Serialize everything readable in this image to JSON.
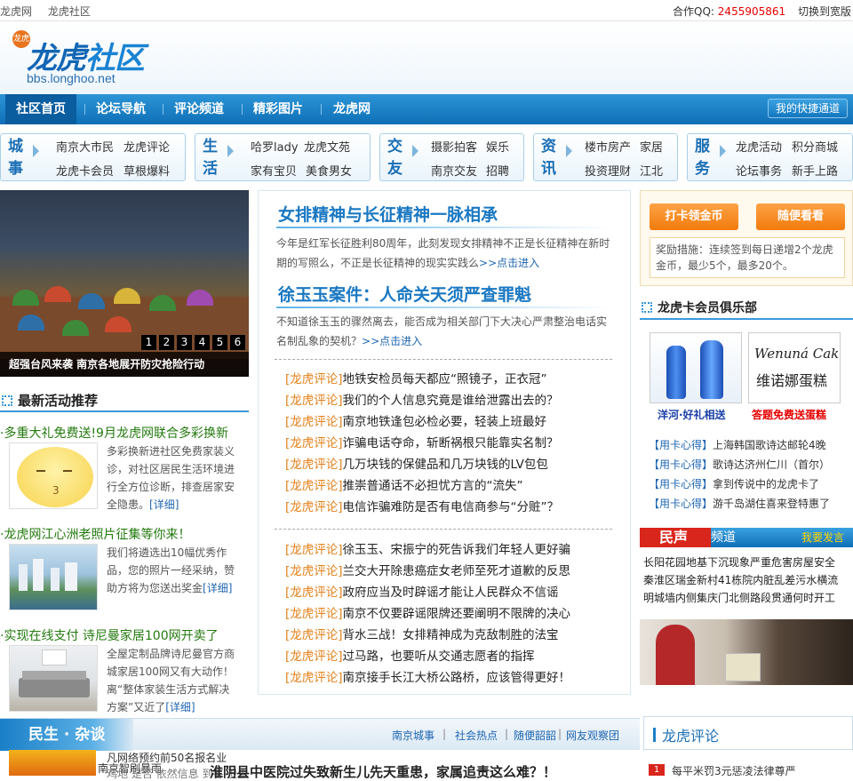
{
  "topbar": {
    "site": "龙虎网",
    "community": "龙虎社区",
    "qq_label": "合作QQ:",
    "qq_number": "2455905861",
    "switch_label": "切换到宽版"
  },
  "logo": {
    "seal": "龙虎",
    "name_a": "龙虎",
    "name_b": "社区",
    "url": "bbs.longhoo.net"
  },
  "nav": {
    "items": [
      "社区首页",
      "论坛导航",
      "评论频道",
      "精彩图片",
      "龙虎网"
    ],
    "quick": "我的快捷通道"
  },
  "categories": [
    {
      "t1": "城",
      "t2": "事",
      "links": [
        "南京大市民",
        "龙虎评论",
        "龙虎卡会员",
        "草根爆料"
      ]
    },
    {
      "t1": "生",
      "t2": "活",
      "links": [
        "哈罗lady",
        "龙虎文苑",
        "家有宝贝",
        "美食男女"
      ]
    },
    {
      "t1": "交",
      "t2": "友",
      "links": [
        "摄影拍客",
        "娱乐",
        "南京交友",
        "招聘"
      ]
    },
    {
      "t1": "资",
      "t2": "讯",
      "links": [
        "楼市房产",
        "家居",
        "投资理财",
        "江北"
      ]
    },
    {
      "t1": "服",
      "t2": "务",
      "links": [
        "龙虎活动",
        "积分商城",
        "论坛事务",
        "新手上路"
      ]
    }
  ],
  "slide": {
    "nums": [
      "1",
      "2",
      "3",
      "4",
      "5",
      "6"
    ],
    "caption": "超强台风来袭 南京各地展开防灾抢险行动"
  },
  "activities": {
    "title": "最新活动推荐",
    "items": [
      {
        "title": "·多重大礼免费送!9月龙虎网联合多彩换新",
        "desc": "多彩换新进社区免费家装义诊，对社区居民生活环境进行全方位诊断，排查居家安全隐患。",
        "more": "[详细]"
      },
      {
        "title": "·龙虎网江心洲老照片征集等你来！",
        "desc": "我们将遴选出10幅优秀作品，您的照片一经采纳，赞助方将为您送出奖金",
        "more": "[详细]"
      },
      {
        "title": "·实现在线支付 诗尼曼家居100网开卖了",
        "desc": "全屋定制品牌诗尼曼官方商城家居100网又有大动作！离“整体家装生活方式解决方案”又近了",
        "more": "[详细]"
      }
    ]
  },
  "middle": {
    "h1": "女排精神与长征精神一脉相承",
    "d1": "今年是红军长征胜利80周年，此刻发现女排精神不正是长征精神在新时期的写照么，不正是长征精神的现实实践么",
    "go1": ">>点击进入",
    "h2": "徐玉玉案件：人命关天须严查罪魁",
    "d2": "不知道徐玉玉的骤然离去，能否成为相关部门下大决心严肃整治电话实名制乱象的契机？",
    "go2": ">>点击进入",
    "list1": [
      {
        "tag": "[龙虎评论]",
        "text": "地铁安检员每天都应“照镜子，正衣冠”"
      },
      {
        "tag": "[龙虎评论]",
        "text": "我们的个人信息究竟是谁给泄露出去的？"
      },
      {
        "tag": "[龙虎评论]",
        "text": "南京地铁逢包必检必要，轻装上班最好"
      },
      {
        "tag": "[龙虎评论]",
        "text": "诈骗电话夺命，斩断祸根只能靠实名制？"
      },
      {
        "tag": "[龙虎评论]",
        "text": "几万块钱的保健品和几万块钱的LV包包"
      },
      {
        "tag": "[龙虎评论]",
        "text": "推崇普通话不必担忧方言的“流失”"
      },
      {
        "tag": "[龙虎评论]",
        "text": "电信诈骗难防是否有电信商参与“分赃”？"
      }
    ],
    "list2": [
      {
        "tag": "[龙虎评论]",
        "text": "徐玉玉、宋振宁的死告诉我们年轻人更好骗"
      },
      {
        "tag": "[龙虎评论]",
        "text": "兰交大开除患癌症女老师至死才道歉的反思"
      },
      {
        "tag": "[龙虎评论]",
        "text": "政府应当及时辟谣才能让人民群众不信谣"
      },
      {
        "tag": "[龙虎评论]",
        "text": "南京不仅要辟谣限牌还要阐明不限牌的决心"
      },
      {
        "tag": "[龙虎评论]",
        "text": "背水三战！女排精神成为克敌制胜的法宝"
      },
      {
        "tag": "[龙虎评论]",
        "text": "过马路，也要听从交通志愿者的指挥"
      },
      {
        "tag": "[龙虎评论]",
        "text": "南京接手长江大桥公路桥，应该管得更好！"
      }
    ]
  },
  "right": {
    "btn1": "打卡领金币",
    "btn2": "随便看看",
    "note": "奖励措施：连续签到每日递增2个龙虎金币，最少5个，最多20个。",
    "club_title": "龙虎卡会员俱乐部",
    "cake_brand": "Wenuná Cake",
    "cake_cn": "维诺娜蛋糕",
    "prod1": "洋河·好礼相送",
    "prod2": "答题免费送蛋糕",
    "club_list": [
      {
        "tag": "【用卡心得】",
        "text": "上海韩国歌诗达邮轮4晚"
      },
      {
        "tag": "【用卡心得】",
        "text": "歌诗达济州仁川（首尔）"
      },
      {
        "tag": "【用卡心得】",
        "text": "拿到传说中的龙虎卡了"
      },
      {
        "tag": "【用卡心得】",
        "text": "游千岛湖住喜来登特惠了"
      }
    ],
    "minsheng_logo": "民声",
    "minsheng_channel": "频道",
    "minsheng_say": "我要发言",
    "minsheng_lines": [
      "长阳花园地基下沉现象严重危害房屋安全",
      "秦淮区瑞金新村41栋院内脏乱差污水横流",
      "明城墙内侧集庆门北侧路段贯通何时开工"
    ]
  },
  "bottom": {
    "section": "民生 · 杂谈",
    "links": [
      "南京城事",
      "社会热点",
      "随便韶韶",
      "网友观察团"
    ],
    "comment_title": "龙虎评论",
    "l1": "凡网络预约前50名报名业",
    "l2": "南京智刷暴雨",
    "l3": "鸡地 是否 依然信息 到答 卫生",
    "headline": "淮阴县中医院过失致新生儿先天重患，家属追责这么难？！",
    "right_line": "每平米罚3元惩凌法律尊严",
    "badge": "1"
  }
}
